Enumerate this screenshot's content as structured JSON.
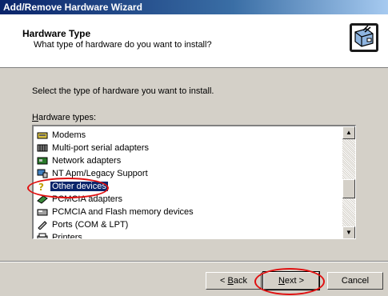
{
  "window": {
    "title": "Add/Remove Hardware Wizard"
  },
  "header": {
    "title": "Hardware Type",
    "subtitle": "What type of hardware do you want to install?",
    "icon": "hardware-wizard-icon"
  },
  "body": {
    "instruction": "Select the type of hardware you want to install.",
    "list_label_accel": "H",
    "list_label_rest": "ardware types:"
  },
  "list": {
    "items": [
      {
        "label": "Modems",
        "icon": "modem-icon"
      },
      {
        "label": "Multi-port serial adapters",
        "icon": "serial-adapter-icon"
      },
      {
        "label": "Network adapters",
        "icon": "network-adapter-icon"
      },
      {
        "label": "NT Apm/Legacy Support",
        "icon": "legacy-support-icon"
      },
      {
        "label": "Other devices",
        "icon": "question-icon",
        "selected": true
      },
      {
        "label": "PCMCIA adapters",
        "icon": "pcmcia-icon"
      },
      {
        "label": "PCMCIA and Flash memory devices",
        "icon": "flash-memory-icon"
      },
      {
        "label": "Ports (COM & LPT)",
        "icon": "port-icon"
      },
      {
        "label": "Printers",
        "icon": "printer-icon"
      }
    ]
  },
  "buttons": {
    "back_accel": "B",
    "back_rest": "ack",
    "back_prefix": "< ",
    "next_accel": "N",
    "next_rest": "ext >",
    "cancel": "Cancel"
  },
  "colors": {
    "highlight": "#0a246a",
    "annotation": "#e01010",
    "face": "#d4d0c8"
  }
}
